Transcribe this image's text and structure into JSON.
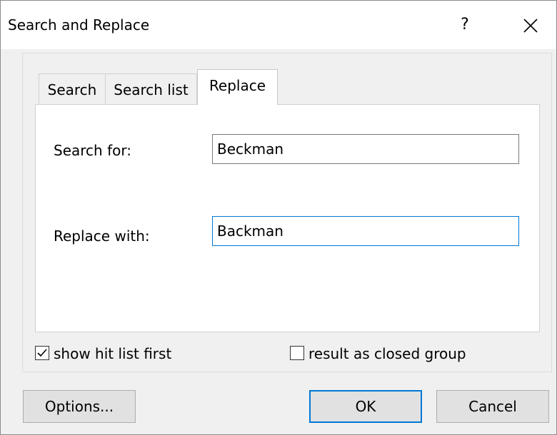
{
  "window": {
    "title": "Search and Replace",
    "help_label": "?",
    "close_icon": "close-icon"
  },
  "tabs": [
    {
      "label": "Search",
      "active": false
    },
    {
      "label": "Search list",
      "active": false
    },
    {
      "label": "Replace",
      "active": true
    }
  ],
  "form": {
    "search_for_label": "Search for:",
    "search_for_value": "Beckman",
    "replace_with_label": "Replace with:",
    "replace_with_value": "Backman"
  },
  "options": {
    "show_hit_list_first": {
      "label": "show hit list first",
      "checked": true
    },
    "result_as_closed_group": {
      "label": "result as closed group",
      "checked": false
    }
  },
  "buttons": {
    "options": "Options...",
    "ok": "OK",
    "cancel": "Cancel"
  },
  "colors": {
    "focus_accent": "#0078d7",
    "dialog_background": "#f0f0f0"
  }
}
